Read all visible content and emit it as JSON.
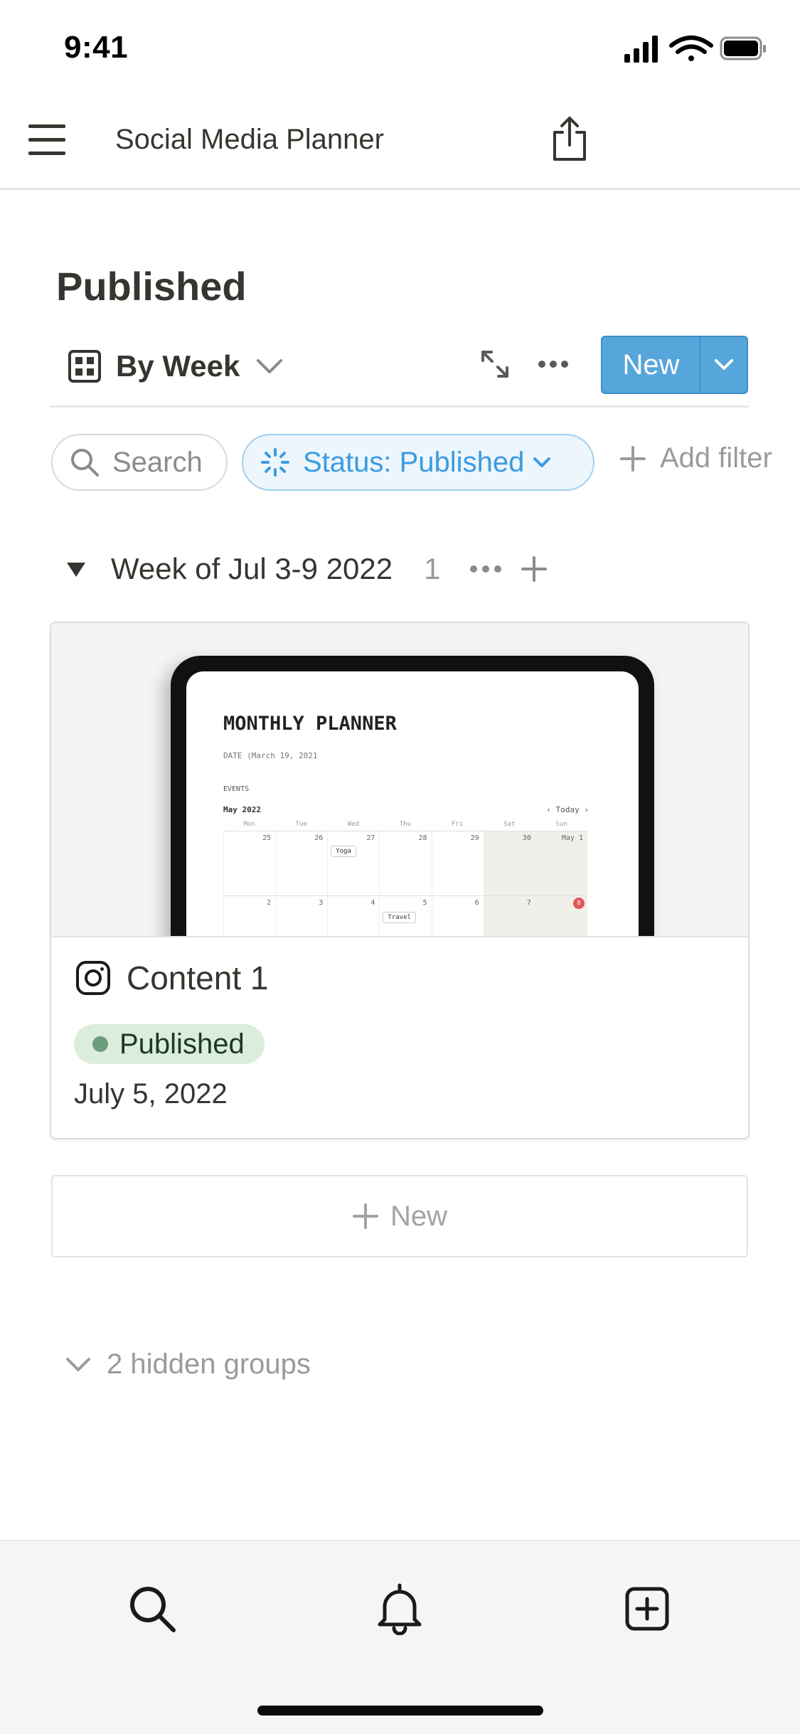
{
  "status_bar": {
    "time": "9:41"
  },
  "nav": {
    "title": "Social Media Planner"
  },
  "page": {
    "title": "Published"
  },
  "view": {
    "label": "By Week",
    "new_label": "New"
  },
  "filters": {
    "search_label": "Search",
    "status_label": "Status: Published",
    "add_filter_label": "Add filter"
  },
  "group": {
    "label": "Week of Jul 3-9 2022",
    "count": "1"
  },
  "card": {
    "title": "Content 1",
    "status": "Published",
    "date": "July 5, 2022",
    "cover": {
      "heading": "MONTHLY PLANNER",
      "date_line": "DATE (March 19, 2021",
      "events_tab": "EVENTS",
      "month": "May 2022",
      "today": "‹ Today ›",
      "weekdays": [
        "Mon",
        "Tue",
        "Wed",
        "Thu",
        "Fri",
        "Sat",
        "Sun"
      ],
      "week1": [
        "25",
        "26",
        "27",
        "28",
        "29",
        "30",
        "May 1"
      ],
      "week2": [
        "2",
        "3",
        "4",
        "5",
        "6",
        "7",
        "8"
      ],
      "event1": "Yoga",
      "event2": "Travel"
    }
  },
  "new_row_label": "New",
  "hidden_groups_label": "2 hidden groups",
  "colors": {
    "accent": "#56a5db",
    "status_bg": "#dbeddb",
    "status_dot": "#6c9b7d",
    "filter_active": "#3b9be0"
  },
  "icons": {
    "menu": "hamburger-menu-icon",
    "share": "share-icon",
    "view": "board-icon",
    "expand": "expand-icon",
    "more": "more-icon",
    "search": "search-icon",
    "status": "status-loader-icon",
    "instagram": "instagram-icon",
    "bell": "bell-icon",
    "new_page": "new-page-icon"
  }
}
